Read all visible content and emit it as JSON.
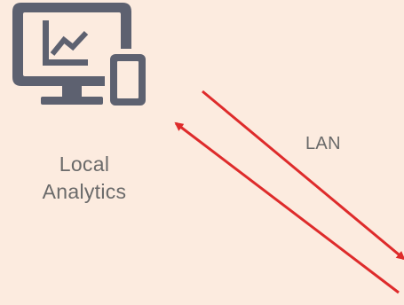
{
  "colors": {
    "background": "#fcebdf",
    "icon": "#5d6170",
    "arrow": "#de2b2b",
    "text": "#6a6a6a"
  },
  "node": {
    "icon": "desktop-tablet-analytics-icon",
    "label_line1": "Local",
    "label_line2": "Analytics"
  },
  "link": {
    "label": "LAN"
  }
}
